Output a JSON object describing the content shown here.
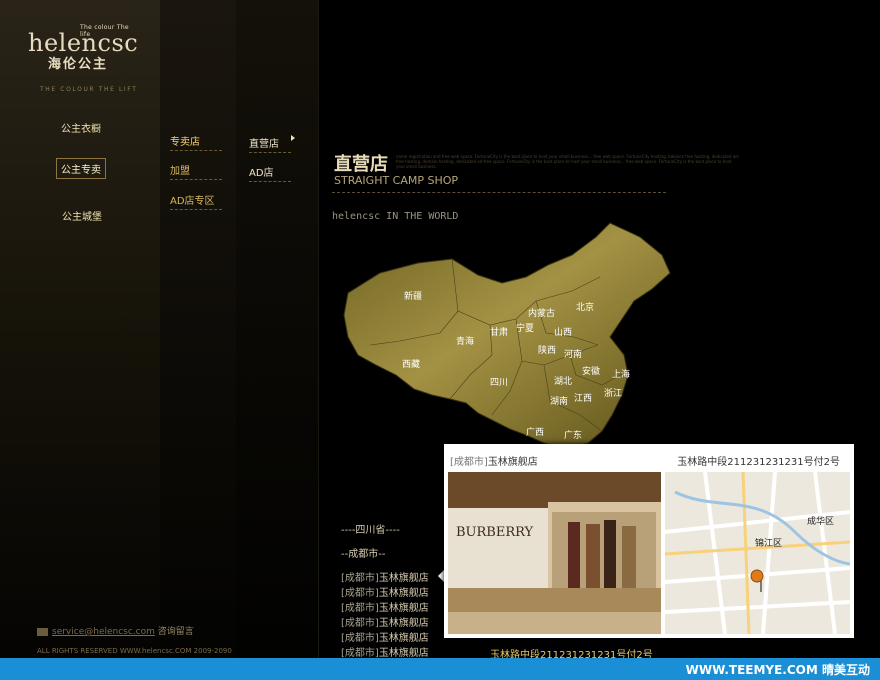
{
  "brand": {
    "tagline_small": "The colour The life",
    "logo_word": "helencsc",
    "logo_cn": "海伦公主",
    "slogan": "THE COLOUR THE LIFT"
  },
  "nav_primary": [
    "公主衣橱",
    "公主专卖",
    "公主城堡"
  ],
  "nav_secondary": [
    "专卖店",
    "加盟",
    "AD店专区"
  ],
  "nav_tertiary": [
    "直营店",
    "AD店"
  ],
  "section": {
    "title": "直营店",
    "subtitle": "STRAIGHT CAMP SHOP",
    "blurb": "name registration and free web space. FortuneCity is the best place to host your small business... free web space. FortuneCity hosting, balance free hosting, dedicated ad-free hosting, domain hosting, dedicated ad-free space. FortuneCity is the best place to host your small business... free web space. FortuneCity is the best place to host your small business.",
    "world_label": "helencsc IN THE WORLD"
  },
  "map": {
    "fill_color": "#8a7a2a",
    "provinces": [
      "新疆",
      "内蒙古",
      "北京",
      "甘肃",
      "宁夏",
      "青海",
      "山西",
      "陕西",
      "河南",
      "西藏",
      "四川",
      "湖北",
      "安徽",
      "上海",
      "湖南",
      "江西",
      "浙江",
      "广西",
      "广东"
    ]
  },
  "store_list": {
    "province_header": "----四川省----",
    "city_header": "--成都市--",
    "items": [
      {
        "tag": "[成都市]",
        "name": "玉林旗舰店"
      },
      {
        "tag": "[成都市]",
        "name": "玉林旗舰店"
      },
      {
        "tag": "[成都市]",
        "name": "玉林旗舰店"
      },
      {
        "tag": "[成都市]",
        "name": "玉林旗舰店"
      },
      {
        "tag": "[成都市]",
        "name": "玉林旗舰店"
      },
      {
        "tag": "[成都市]",
        "name": "玉林旗舰店"
      }
    ],
    "under_address": "玉林路中段211231231231号付2号"
  },
  "popup": {
    "tag": "[成都市]",
    "name": "玉林旗舰店",
    "address": "玉林路中段211231231231号付2号",
    "photo_sign": "BURBERRY",
    "map_labels": [
      "成华区",
      "锦江区"
    ]
  },
  "footer": {
    "email": "service@helencsc.com",
    "contact": "咨询留言",
    "copyright": "ALL RIGHTS RESERVED WWW.helencsc.COM 2009-2090"
  },
  "watermark": "WWW.TEEMYE.COM 晴美互动"
}
